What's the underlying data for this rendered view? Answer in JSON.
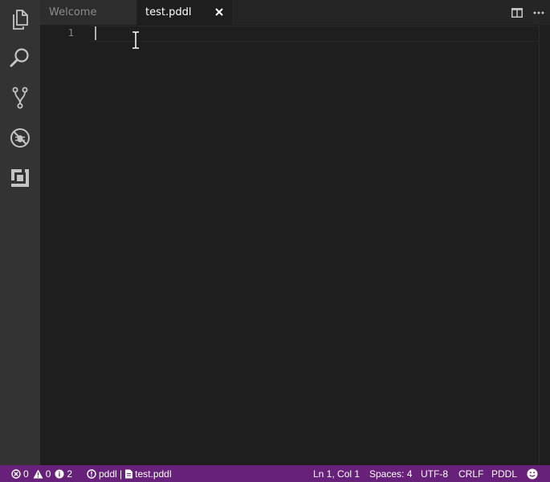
{
  "activity_bar": {
    "items": [
      {
        "icon": "files-icon"
      },
      {
        "icon": "search-icon"
      },
      {
        "icon": "source-control-icon"
      },
      {
        "icon": "debug-icon"
      },
      {
        "icon": "extensions-icon"
      }
    ]
  },
  "tabs": [
    {
      "label": "Welcome",
      "active": false
    },
    {
      "label": "test.pddl",
      "active": true
    }
  ],
  "editor_actions": [
    {
      "icon": "split-editor-icon"
    },
    {
      "icon": "more-actions-icon"
    }
  ],
  "editor": {
    "line_numbers": [
      "1"
    ],
    "content": ""
  },
  "status_bar": {
    "errors": "0",
    "warnings": "0",
    "infos": "2",
    "language_server": "pddl |",
    "file": "test.pddl",
    "cursor_position": "Ln 1, Col 1",
    "indentation": "Spaces: 4",
    "encoding": "UTF-8",
    "line_ending": "CRLF",
    "language_mode": "PDDL",
    "feedback_icon": "smiley-icon"
  },
  "colors": {
    "status_bar_bg": "#68217a",
    "activity_bar_bg": "#333333",
    "editor_bg": "#1e1e1e",
    "tab_inactive_bg": "#2d2d2d"
  }
}
